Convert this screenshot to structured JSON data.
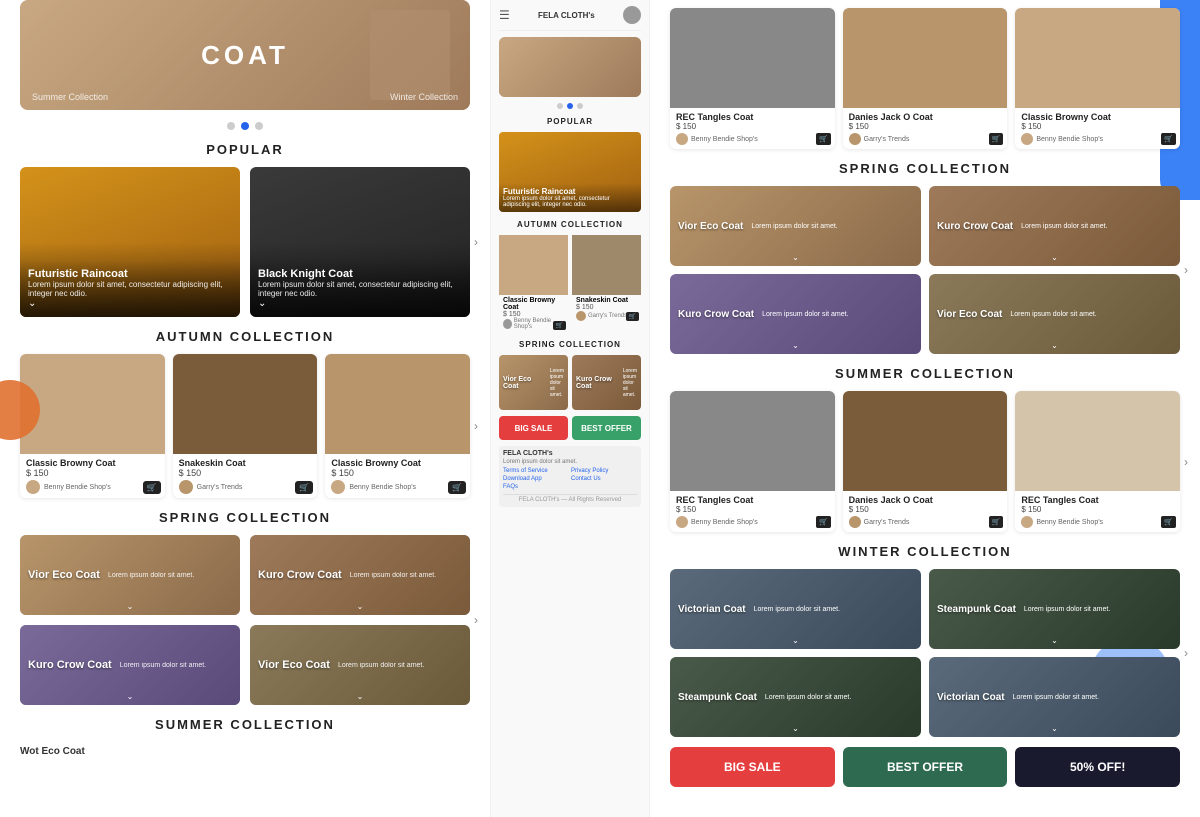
{
  "app": {
    "name": "FELA CLOTH's",
    "tagline": "Lorem ipsum dolor sit amet."
  },
  "hero": {
    "title": "COAT",
    "subtitle_left": "Summer Collection",
    "subtitle_right": "Winter Collection"
  },
  "dots": [
    false,
    true,
    false
  ],
  "sections": {
    "popular": "POPULAR",
    "autumn": "AUTUMN COLLECTION",
    "spring": "SPRING COLLECTION",
    "summer": "SUMMER COLLECTION",
    "winter": "WINTER COLLECTION"
  },
  "popular_products": [
    {
      "name": "Futuristic Raincoat",
      "desc": "Lorem ipsum dolor sit amet, consectetur adipiscing elit, integer nec odio."
    },
    {
      "name": "Black Knight Coat",
      "desc": "Lorem ipsum dolor sit amet, consectetur adipiscing elit, integer nec odio."
    }
  ],
  "autumn_products": [
    {
      "name": "Classic Browny Coat",
      "price": "$ 150",
      "seller": "Benny Bendie Shop's"
    },
    {
      "name": "Snakeskin Coat",
      "price": "$ 150",
      "seller": "Garry's Trends"
    },
    {
      "name": "Classic Browny Coat",
      "price": "$ 150",
      "seller": "Benny Bendie Shop's"
    }
  ],
  "spring_products_left": [
    {
      "name": "Vior Eco Coat",
      "desc": "Lorem ipsum dolor sit amet."
    },
    {
      "name": "Kuro Crow Coat",
      "desc": "Lorem ipsum dolor sit amet."
    }
  ],
  "spring_products_right": [
    {
      "name": "Kuro Crow Coat",
      "desc": "Lorem ipsum dolor sit amet."
    },
    {
      "name": "Vior Eco Coat",
      "desc": "Lorem ipsum dolor sit amet."
    }
  ],
  "right_hero_products": [
    {
      "name": "REC Tangles Coat",
      "price": "$ 150",
      "seller": "Benny Bendie Shop's"
    },
    {
      "name": "Danies Jack O Coat",
      "price": "$ 150",
      "seller": "Garry's Trends"
    },
    {
      "name": "Classic Browny Coat",
      "price": "$ 150",
      "seller": "Benny Bendie Shop's"
    }
  ],
  "right_autumn_products": [
    {
      "name": "Classic Browny Coat",
      "price": "$ 150",
      "seller": "Benny Bendie Shop's"
    },
    {
      "name": "Snakeskin Coat",
      "price": "$ 150",
      "seller": "Garry's Trends"
    },
    {
      "name": "Classic Browny Coat",
      "price": "$ 150",
      "seller": "Benny Bendie Shop's"
    }
  ],
  "right_spring_products": [
    {
      "name": "Vior Eco Coat",
      "desc": "Lorem ipsum dolor sit amet."
    },
    {
      "name": "Kuro Crow Coat",
      "desc": "Lorem ipsum dolor sit amet."
    },
    {
      "name": "Kuro Crow Coat",
      "desc": "Lorem ipsum dolor sit amet."
    },
    {
      "name": "Vior Eco Coat",
      "desc": "Lorem ipsum dolor sit amet."
    }
  ],
  "right_summer_products": [
    {
      "name": "REC Tangles Coat",
      "price": "$ 150",
      "seller": "Benny Bendie Shop's"
    },
    {
      "name": "Danies Jack O Coat",
      "price": "$ 150",
      "seller": "Garry's Trends"
    },
    {
      "name": "REC Tangles Coat",
      "price": "$ 150",
      "seller": "Benny Bendie Shop's"
    }
  ],
  "right_winter_products": [
    {
      "name": "Victorian Coat",
      "desc": "Lorem ipsum dolor sit amet."
    },
    {
      "name": "Steampunk Coat",
      "desc": "Lorem ipsum dolor sit amet."
    },
    {
      "name": "Steampunk Coat",
      "desc": "Lorem ipsum dolor sit amet."
    },
    {
      "name": "Victorian Coat",
      "desc": "Lorem ipsum dolor sit amet."
    }
  ],
  "sale_banners": [
    {
      "label": "BIG SALE",
      "color": "#e53e3e"
    },
    {
      "label": "BEST OFFER",
      "color": "#2d6a4f"
    },
    {
      "label": "50% OFF!",
      "color": "#1a1a2e"
    }
  ],
  "mid_sale_banners": [
    {
      "label": "BIG SALE",
      "color": "#e53e3e"
    },
    {
      "label": "BEST OFFER",
      "color": "#38a169"
    }
  ],
  "footer": {
    "brand": "FELA CLOTH's",
    "tagline": "Lorem ipsum dolor sit amet.",
    "links": [
      "Terms of Service",
      "Privacy Policy",
      "Download App",
      "Contact Us",
      "FAQs"
    ],
    "copyright": "FELA CLOTH's — All Rights Reserved"
  },
  "wot_eco_coat": "Wot Eco Coat"
}
